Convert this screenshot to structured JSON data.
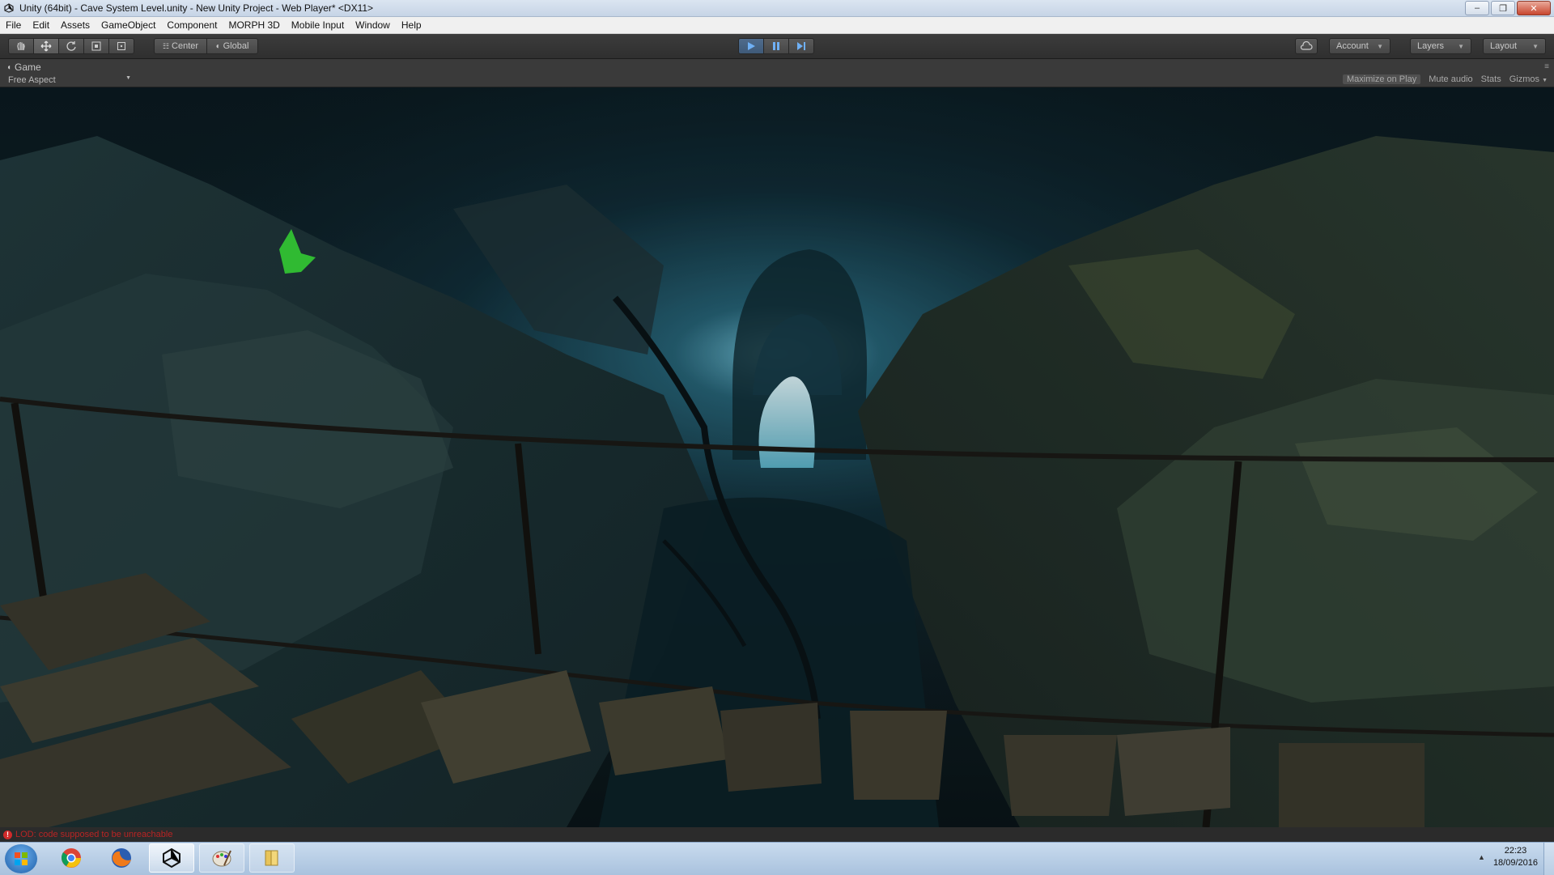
{
  "window": {
    "title": "Unity (64bit) - Cave System Level.unity - New Unity Project - Web Player* <DX11>",
    "controls": [
      "minimize-icon",
      "restore-icon",
      "close-icon"
    ]
  },
  "menu": [
    "File",
    "Edit",
    "Assets",
    "GameObject",
    "Component",
    "MORPH 3D",
    "Mobile Input",
    "Window",
    "Help"
  ],
  "toolbar": {
    "tools": [
      "hand-icon",
      "move-icon",
      "rotate-icon",
      "scale-icon",
      "rect-icon"
    ],
    "pivot_label": "Center",
    "space_label": "Global",
    "account_label": "Account",
    "layers_label": "Layers",
    "layout_label": "Layout",
    "accent_color": "#4f6c8c"
  },
  "game_view": {
    "tab_label": "Game",
    "aspect_label": "Free Aspect",
    "maximize_label": "Maximize on Play",
    "mute_label": "Mute audio",
    "stats_label": "Stats",
    "gizmos_label": "Gizmos"
  },
  "status": {
    "message": "LOD: code supposed to be unreachable",
    "color": "#b92424"
  },
  "taskbar": {
    "apps": [
      "chrome-icon",
      "firefox-icon",
      "unity-icon",
      "paint-icon",
      "explorer-icon"
    ],
    "time": "22:23",
    "date": "18/09/2016"
  }
}
